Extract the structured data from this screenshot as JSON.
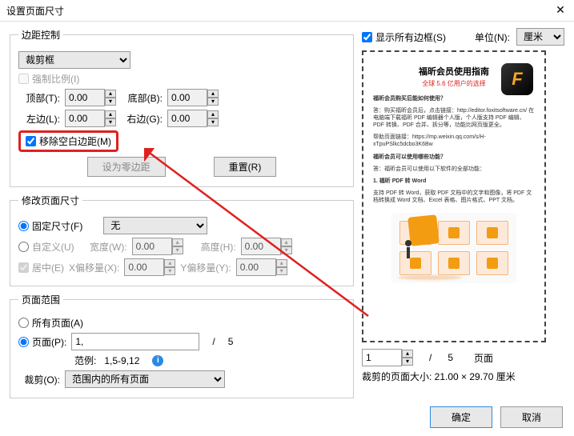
{
  "title": "设置页面尺寸",
  "margin": {
    "legend": "边距控制",
    "crop_type": "裁剪框",
    "constrain": "强制比例(I)",
    "top_lbl": "顶部(T):",
    "top_val": "0.00",
    "bottom_lbl": "底部(B):",
    "bottom_val": "0.00",
    "left_lbl": "左边(L):",
    "left_val": "0.00",
    "right_lbl": "右边(G):",
    "right_val": "0.00",
    "remove_white": "移除空白边距(M)",
    "zero_btn": "设为零边距",
    "reset_btn": "重置(R)"
  },
  "size": {
    "legend": "修改页面尺寸",
    "fixed": "固定尺寸(F)",
    "fixed_val": "无",
    "custom": "自定义(U)",
    "width_lbl": "宽度(W):",
    "width_val": "0.00",
    "height_lbl": "高度(H):",
    "height_val": "0.00",
    "center": "居中(E)",
    "xoff_lbl": "X偏移量(X):",
    "xoff_val": "0.00",
    "yoff_lbl": "Y偏移量(Y):",
    "yoff_val": "0.00"
  },
  "range": {
    "legend": "页面范围",
    "all": "所有页面(A)",
    "pages": "页面(P):",
    "pages_val": "1,",
    "of": "/",
    "total": "5",
    "example_lbl": "范例:",
    "example_val": "1,5-9,12",
    "crop_lbl": "裁剪(O):",
    "crop_val": "范围内的所有页面"
  },
  "rightside": {
    "show_all": "显示所有边框(S)",
    "unit_lbl": "单位(N):",
    "unit_val": "厘米",
    "nav_page": "1",
    "nav_of": "/",
    "nav_total": "5",
    "nav_pg": "页面",
    "crop_size": "裁剪的页面大小: 21.00 × 29.70 厘米"
  },
  "preview": {
    "title": "福昕会员使用指南",
    "sub": "全球 5.6 亿用户的选择",
    "q1": "福昕会员购买后能如何使用？",
    "a1": "答：购买福昕会员后，点击链接：http://editor.foxitsoftware.cn/ 在电脑端下载福昕 PDF 编辑器个人版，个人版支持 PDF 编辑、PDF 转换、PDF 合并、拆分等，功能比网页版更全。",
    "help": "帮助页面链接：https://mp.weixin.qq.com/s/H-xTpuPSlkc5dcbo3K6Bw",
    "q2": "福昕会员可以使用哪些功能？",
    "a2": "答：福昕会员可以使用以下软件的全部功能：",
    "p1": "1. 福昕 PDF 转 Word",
    "p2": "支持 PDF 转 Word，获取 PDF 文档中的文字和图像，将 PDF 文档转换成 Word 文档、Excel 表格、图片格式、PPT 文档。"
  },
  "buttons": {
    "ok": "确定",
    "cancel": "取消"
  }
}
